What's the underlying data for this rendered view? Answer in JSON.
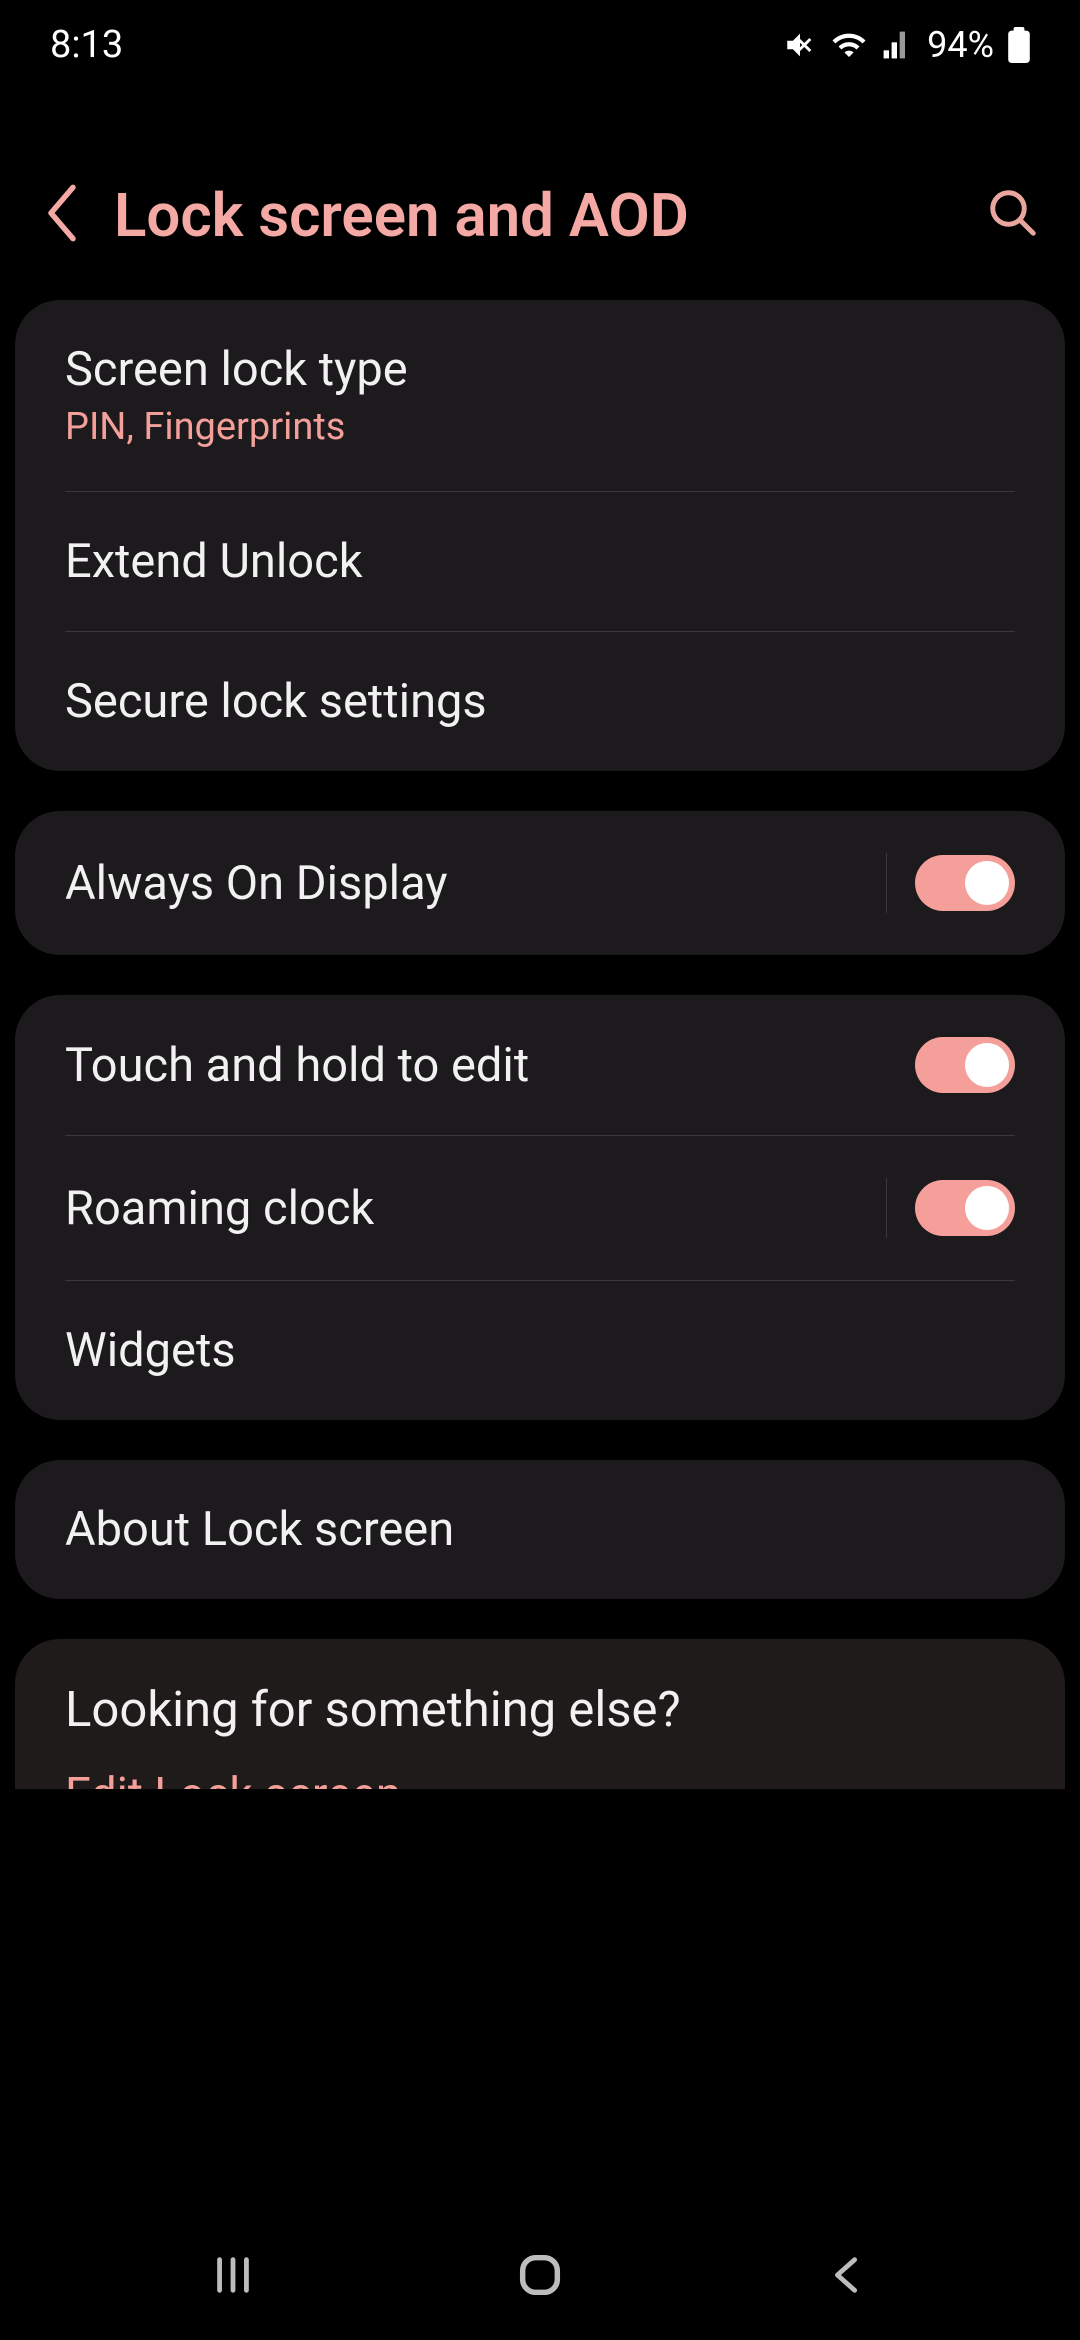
{
  "status": {
    "time": "8:13",
    "battery": "94%"
  },
  "header": {
    "title": "Lock screen and AOD"
  },
  "groups": [
    {
      "rows": [
        {
          "title": "Screen lock type",
          "sub": "PIN, Fingerprints"
        },
        {
          "title": "Extend Unlock"
        },
        {
          "title": "Secure lock settings"
        }
      ]
    },
    {
      "rows": [
        {
          "title": "Always On Display",
          "toggle": true
        }
      ]
    },
    {
      "rows": [
        {
          "title": "Touch and hold to edit",
          "toggle": true
        },
        {
          "title": "Roaming clock",
          "toggle": true
        },
        {
          "title": "Widgets"
        }
      ]
    },
    {
      "rows": [
        {
          "title": "About Lock screen"
        }
      ]
    }
  ],
  "looking": {
    "title": "Looking for something else?",
    "link": "Edit Lock screen"
  }
}
